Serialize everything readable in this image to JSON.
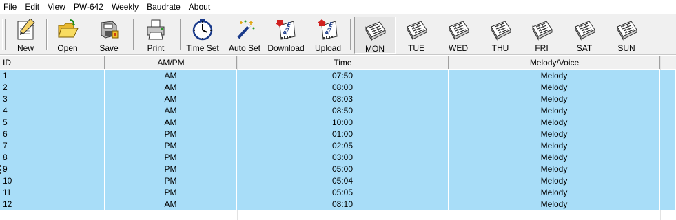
{
  "menu": [
    "File",
    "Edit",
    "View",
    "PW-642",
    "Weekly",
    "Baudrate",
    "About"
  ],
  "toolbar": {
    "new": "New",
    "open": "Open",
    "save": "Save",
    "print": "Print",
    "time_set": "Time Set",
    "auto_set": "Auto Set",
    "download": "Download",
    "upload": "Upload",
    "days": [
      "MON",
      "TUE",
      "WED",
      "THU",
      "FRI",
      "SAT",
      "SUN"
    ],
    "selected_day": "MON",
    "icon_ram_text": "Ram"
  },
  "table": {
    "columns": [
      "ID",
      "AM/PM",
      "Time",
      "Melody/Voice"
    ],
    "rows": [
      [
        "1",
        "AM",
        "07:50",
        "Melody"
      ],
      [
        "2",
        "AM",
        "08:00",
        "Melody"
      ],
      [
        "3",
        "AM",
        "08:03",
        "Melody"
      ],
      [
        "4",
        "AM",
        "08:50",
        "Melody"
      ],
      [
        "5",
        "AM",
        "10:00",
        "Melody"
      ],
      [
        "6",
        "PM",
        "01:00",
        "Melody"
      ],
      [
        "7",
        "PM",
        "02:05",
        "Melody"
      ],
      [
        "8",
        "PM",
        "03:00",
        "Melody"
      ],
      [
        "9",
        "PM",
        "05:00",
        "Melody"
      ],
      [
        "10",
        "PM",
        "05:04",
        "Melody"
      ],
      [
        "11",
        "PM",
        "05:05",
        "Melody"
      ],
      [
        "12",
        "AM",
        "08:10",
        "Melody"
      ]
    ],
    "focused_row": 8
  },
  "colors": {
    "row_highlight": "#a8ddf8",
    "toolbar_bg": "#f0f0f0"
  }
}
